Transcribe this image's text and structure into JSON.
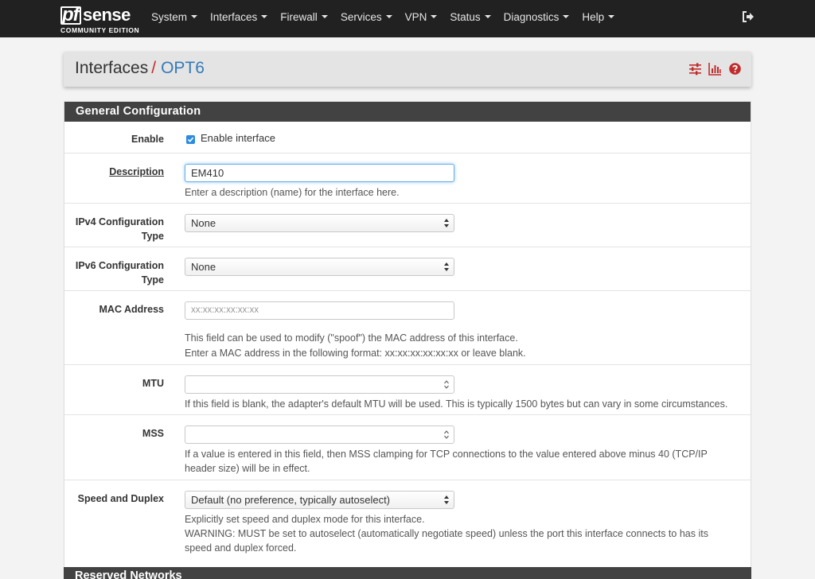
{
  "brand": {
    "name_pf": "pf",
    "name_sense": "sense",
    "edition": "COMMUNITY EDITION"
  },
  "nav": {
    "items": [
      {
        "label": "System"
      },
      {
        "label": "Interfaces"
      },
      {
        "label": "Firewall"
      },
      {
        "label": "Services"
      },
      {
        "label": "VPN"
      },
      {
        "label": "Status"
      },
      {
        "label": "Diagnostics"
      },
      {
        "label": "Help"
      }
    ],
    "logout_icon": "sign-out-icon"
  },
  "breadcrumb": {
    "parent": "Interfaces",
    "separator": "/",
    "current": "OPT6",
    "icons": [
      "sliders-icon",
      "bar-chart-icon",
      "question-circle-icon"
    ]
  },
  "general": {
    "heading": "General Configuration",
    "enable": {
      "label": "Enable",
      "checkbox_label": "Enable interface",
      "checked": true
    },
    "description": {
      "label": "Description",
      "value": "EM410",
      "help": "Enter a description (name) for the interface here."
    },
    "ipv4": {
      "label_line1": "IPv4 Configuration",
      "label_line2": "Type",
      "value": "None"
    },
    "ipv6": {
      "label_line1": "IPv6 Configuration",
      "label_line2": "Type",
      "value": "None"
    },
    "mac": {
      "label": "MAC Address",
      "placeholder": "xx:xx:xx:xx:xx:xx",
      "help1": "This field can be used to modify (\"spoof\") the MAC address of this interface.",
      "help2": "Enter a MAC address in the following format: xx:xx:xx:xx:xx:xx or leave blank."
    },
    "mtu": {
      "label": "MTU",
      "value": "",
      "help": "If this field is blank, the adapter's default MTU will be used. This is typically 1500 bytes but can vary in some circumstances."
    },
    "mss": {
      "label": "MSS",
      "value": "",
      "help1": "If a value is entered in this field, then MSS clamping for TCP connections to the value entered above minus 40 (TCP/IP",
      "help2": "header size) will be in effect."
    },
    "speed": {
      "label": "Speed and Duplex",
      "value": "Default (no preference, typically autoselect)",
      "help1": "Explicitly set speed and duplex mode for this interface.",
      "help2": "WARNING: MUST be set to autoselect (automatically negotiate speed) unless the port this interface connects to has its",
      "help3": "speed and duplex forced."
    }
  },
  "reserved": {
    "heading": "Reserved Networks"
  },
  "colors": {
    "navbar": "#212121",
    "accent_red": "#c12b2b",
    "link_blue": "#347ab9",
    "panel_heading": "#424242",
    "checkbox_blue": "#2b8be0"
  }
}
